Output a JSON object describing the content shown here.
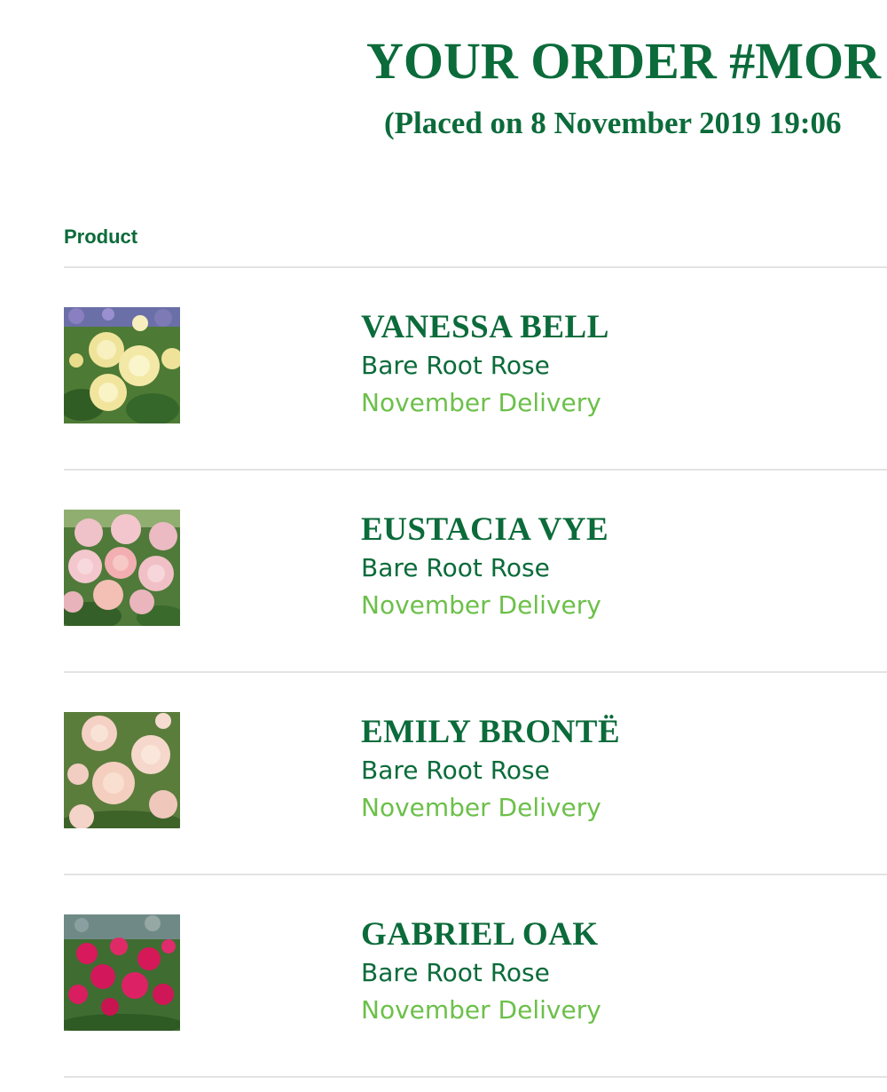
{
  "order": {
    "title": "YOUR ORDER #MOR",
    "placed": "(Placed on 8 November 2019 19:06"
  },
  "table": {
    "header_product": "Product"
  },
  "items": [
    {
      "name": "VANESSA BELL",
      "type": "Bare Root Rose",
      "delivery": "November Delivery",
      "image": "yellow-rose-photo",
      "flower_color": "#f4eaa5"
    },
    {
      "name": "EUSTACIA VYE",
      "type": "Bare Root Rose",
      "delivery": "November Delivery",
      "image": "pink-rose-photo",
      "flower_color": "#f2bcc4"
    },
    {
      "name": "EMILY BRONTË",
      "type": "Bare Root Rose",
      "delivery": "November Delivery",
      "image": "blush-rose-photo",
      "flower_color": "#f6d4c8"
    },
    {
      "name": "GABRIEL OAK",
      "type": "Bare Root Rose",
      "delivery": "November Delivery",
      "image": "magenta-rose-photo",
      "flower_color": "#d81a5c"
    }
  ],
  "colors": {
    "brand_green": "#0b6b3a",
    "delivery_green": "#6cc04a",
    "divider": "#e3e3e3"
  }
}
